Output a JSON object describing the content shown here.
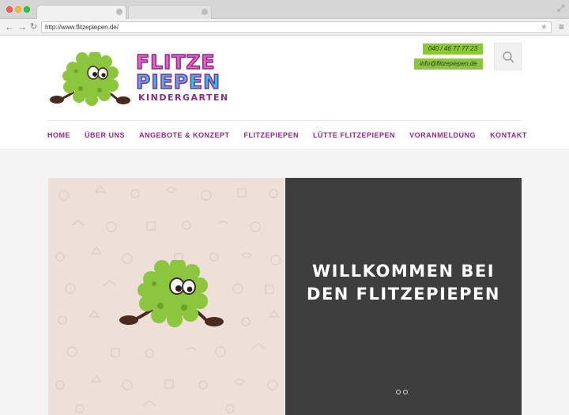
{
  "browser": {
    "url": "http://www.flitzepiepen.de/",
    "icons": {
      "back": "back-arrow-icon",
      "forward": "forward-arrow-icon",
      "reload": "reload-icon",
      "star": "star-icon",
      "menu": "hamburger-menu-icon",
      "resize": "resize-icon"
    }
  },
  "header": {
    "logo": {
      "line1": "FLITZE",
      "line2": "PIEPEN",
      "line3": "KINDERGARTEN",
      "colors": {
        "pink": "#e361c6",
        "blue": "#3bb6ef",
        "purple": "#8a2d86",
        "mascot_green": "#8cc63e"
      }
    },
    "contact": {
      "phone": "040 / 46 77 77 23",
      "email": "info@flitzepiepen.de"
    },
    "search_icon": "search-icon"
  },
  "nav": {
    "items": [
      "HOME",
      "ÜBER UNS",
      "ANGEBOTE & KONZEPT",
      "FLITZEPIEPEN",
      "LÜTTE FLITZEPIEPEN",
      "VORANMELDUNG",
      "KONTAKT"
    ],
    "color": "#8e2b8e"
  },
  "hero": {
    "title_line1": "WILLKOMMEN BEI",
    "title_line2": "DEN FLITZEPIEPEN",
    "slides": 2,
    "active_slide": 1,
    "colors": {
      "left_bg": "#efdfd9",
      "right_bg": "#3e3e3e"
    }
  }
}
